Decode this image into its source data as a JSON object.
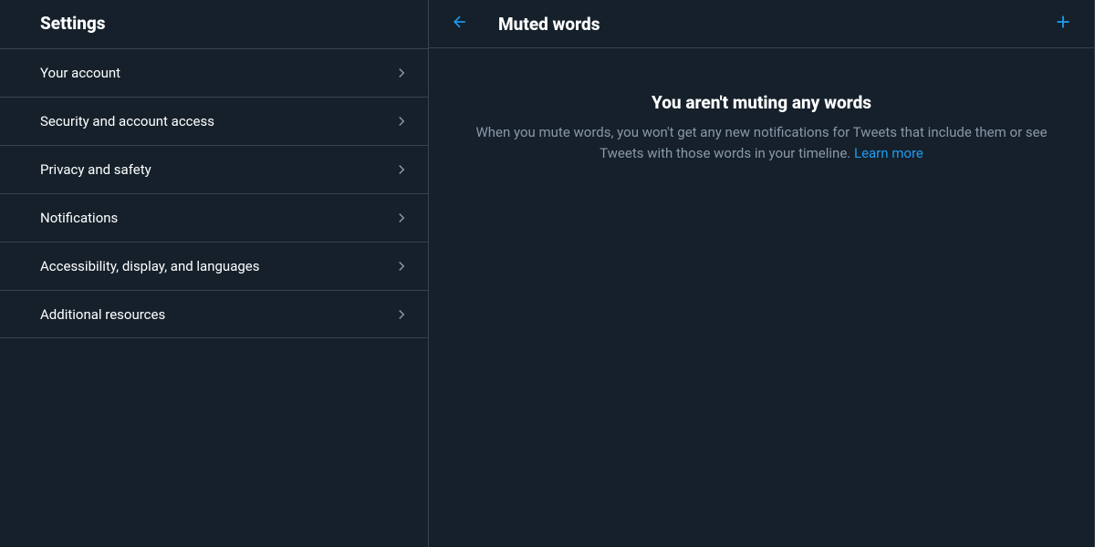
{
  "sidebar": {
    "title": "Settings",
    "items": [
      {
        "label": "Your account"
      },
      {
        "label": "Security and account access"
      },
      {
        "label": "Privacy and safety"
      },
      {
        "label": "Notifications"
      },
      {
        "label": "Accessibility, display, and languages"
      },
      {
        "label": "Additional resources"
      }
    ]
  },
  "main": {
    "title": "Muted words",
    "empty": {
      "headline": "You aren't muting any words",
      "description": "When you mute words, you won't get any new notifications for Tweets that include them or see Tweets with those words in your timeline. ",
      "learn_more": "Learn more"
    }
  },
  "colors": {
    "accent": "#1d9bf0",
    "bg": "#15202b",
    "border": "#38444d",
    "muted_text": "#8899a6"
  }
}
